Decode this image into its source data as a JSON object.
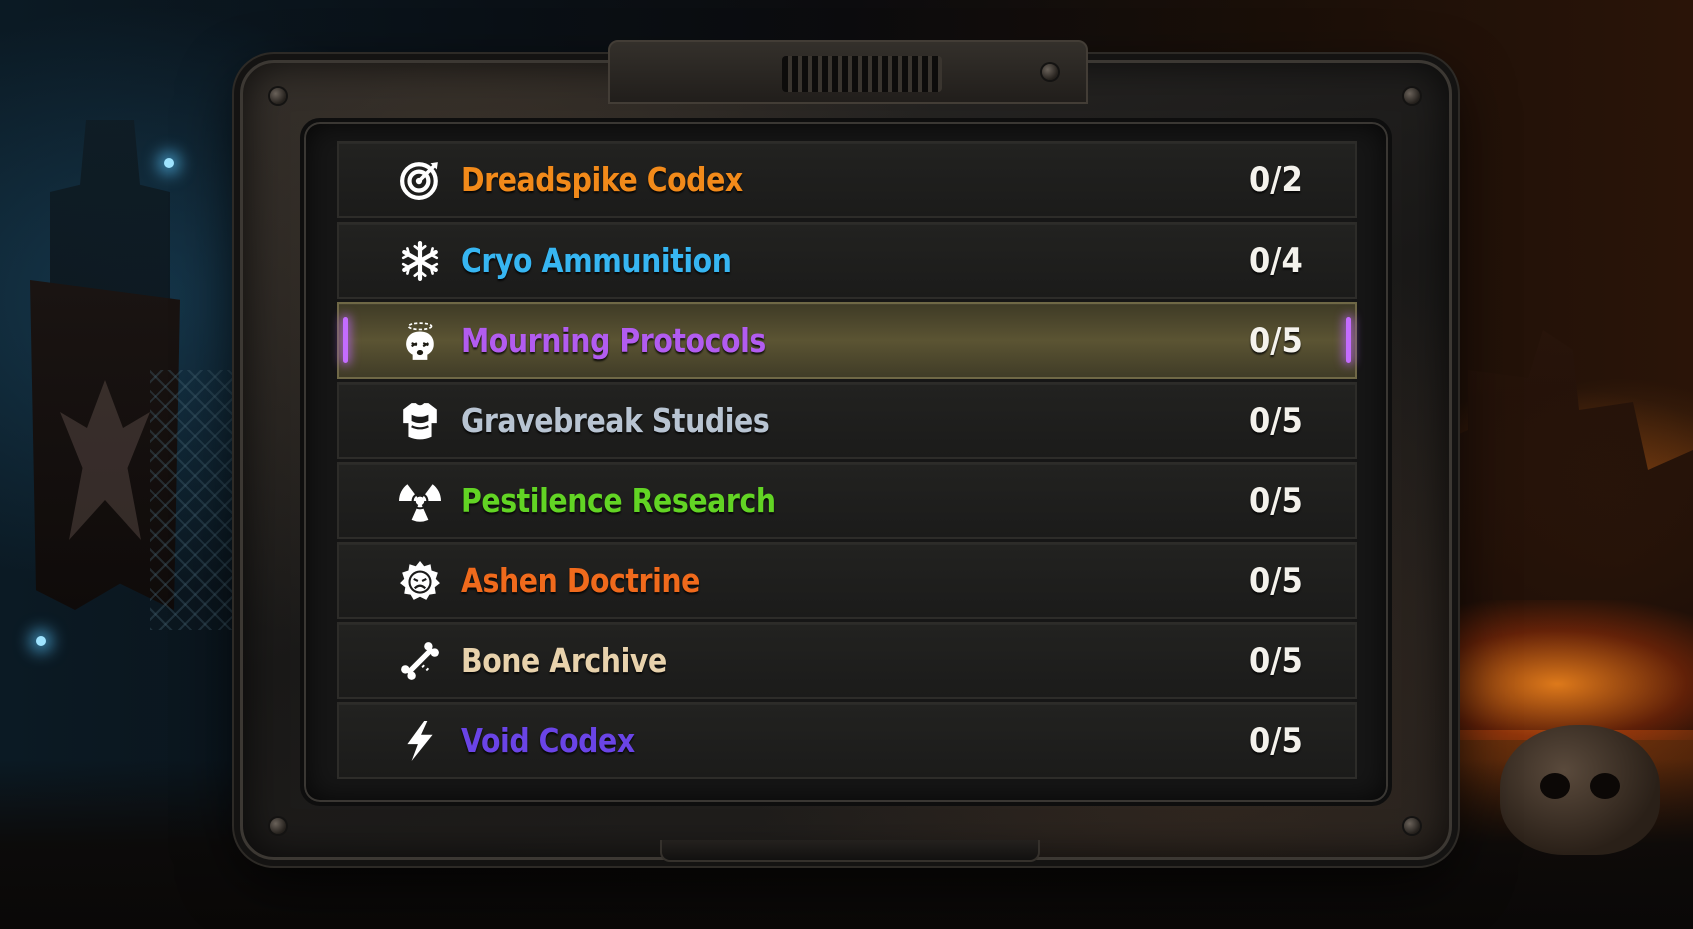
{
  "research_list": {
    "selected_index": 2,
    "rows": [
      {
        "icon": "target-icon",
        "name": "Dreadspike Codex",
        "progress": "0/2",
        "color": "#f28a1a"
      },
      {
        "icon": "snowflake-icon",
        "name": "Cryo Ammunition",
        "progress": "0/4",
        "color": "#37b6f2"
      },
      {
        "icon": "dazed-skull-icon",
        "name": "Mourning Protocols",
        "progress": "0/5",
        "color": "#b25cf0"
      },
      {
        "icon": "armor-vest-icon",
        "name": "Gravebreak Studies",
        "progress": "0/5",
        "color": "#b8c4d2"
      },
      {
        "icon": "radiation-icon",
        "name": "Pestilence Research",
        "progress": "0/5",
        "color": "#62d424"
      },
      {
        "icon": "sad-face-badge-icon",
        "name": "Ashen Doctrine",
        "progress": "0/5",
        "color": "#f06a1c"
      },
      {
        "icon": "bone-icon",
        "name": "Bone Archive",
        "progress": "0/5",
        "color": "#e8d2ac"
      },
      {
        "icon": "lightning-bolt-icon",
        "name": "Void Codex",
        "progress": "0/5",
        "color": "#6a44e6"
      }
    ]
  },
  "colors": {
    "selection_accent": "#c46cff",
    "selected_row_fill": "#5b5433"
  }
}
